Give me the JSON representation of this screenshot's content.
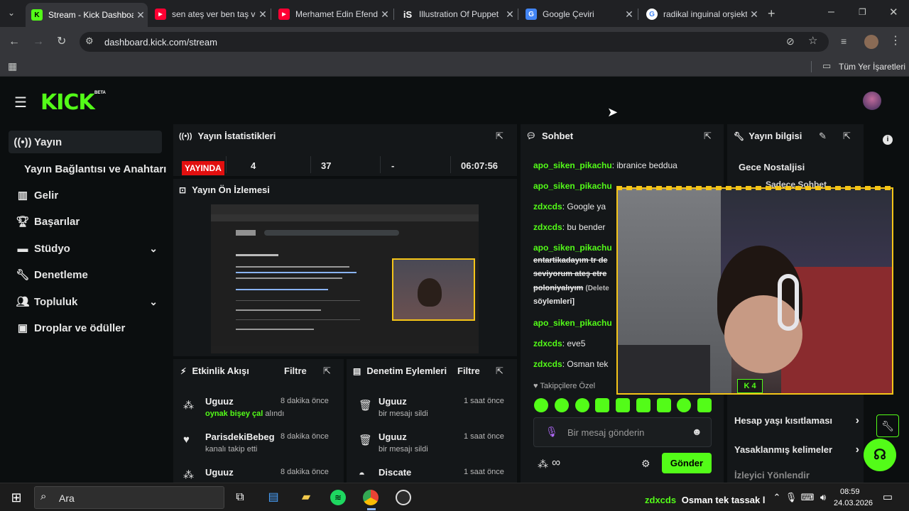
{
  "browser": {
    "tabs": [
      {
        "title": "Stream - Kick Dashboard",
        "favicon": "kick-icon",
        "color": "#53fc18"
      },
      {
        "title": "sen ateş ver ben taş ver",
        "favicon": "youtube-icon",
        "color": "#ff0033"
      },
      {
        "title": "Merhamet Edin Efendi",
        "favicon": "youtube-icon",
        "color": "#ff0033"
      },
      {
        "title": "Illustration Of Puppet",
        "favicon": "istock-icon",
        "color": "#ffffff"
      },
      {
        "title": "Google Çeviri",
        "favicon": "translate-icon",
        "color": "#4285f4"
      },
      {
        "title": "radikal inguinal orşiekt",
        "favicon": "google-icon",
        "color": "#ffffff"
      }
    ],
    "url": "dashboard.kick.com/stream",
    "bookmarks_label": "Tüm Yer İşaretleri"
  },
  "brand": {
    "logo": "KICK",
    "beta": "BETA",
    "accent": "#53fc18"
  },
  "sidebar": {
    "items": [
      {
        "label": "Yayın",
        "icon": "broadcast-icon"
      },
      {
        "label": "Yayın Bağlantısı ve Anahtarı",
        "icon": ""
      },
      {
        "label": "Gelir",
        "icon": "chart-icon"
      },
      {
        "label": "Başarılar",
        "icon": "trophy-icon"
      },
      {
        "label": "Stüdyo",
        "icon": "studio-icon"
      },
      {
        "label": "Denetleme",
        "icon": "wrench-icon"
      },
      {
        "label": "Topluluk",
        "icon": "people-icon"
      },
      {
        "label": "Droplar ve ödüller",
        "icon": "gift-icon"
      }
    ]
  },
  "stats": {
    "title": "Yayın İstatistikleri",
    "live_badge": "YAYINDA",
    "viewers": "4",
    "followers": "37",
    "subs": "-",
    "uptime": "06:07:56"
  },
  "preview": {
    "title": "Yayın Ön İzlemesi"
  },
  "activity": {
    "title": "Etkinlik Akışı",
    "filter": "Filtre",
    "items": [
      {
        "user": "Uguuz",
        "highlight": "oynak bişey çal",
        "text": " alındı",
        "time": "8 dakika önce"
      },
      {
        "user": "ParisdekiBebeg",
        "highlight": "",
        "text": "kanalı takip etti",
        "time": "8 dakika önce"
      },
      {
        "user": "Uguuz",
        "highlight": "",
        "text": "",
        "time": "8 dakika önce"
      }
    ]
  },
  "moderation": {
    "title": "Denetim Eylemleri",
    "filter": "Filtre",
    "items": [
      {
        "user": "Uguuz",
        "text": "bir mesajı sildi",
        "time": "1 saat önce"
      },
      {
        "user": "Uguuz",
        "text": "bir mesajı sildi",
        "time": "1 saat önce"
      },
      {
        "user": "Discate",
        "text": "",
        "time": "1 saat önce"
      }
    ]
  },
  "chat": {
    "title": "Sohbet",
    "messages": [
      {
        "user": "apo_siken_pikachu",
        "text": ": ibranice beddua"
      },
      {
        "user": "apo_siken_pikachu",
        "text": ""
      },
      {
        "user": "zdxcds",
        "text": ": Google ya"
      },
      {
        "user": "zdxcds",
        "text": ": bu bender"
      },
      {
        "user": "apo_siken_pikachu",
        "text": ""
      },
      {
        "user": "",
        "text": "entartikadayım tr de"
      },
      {
        "user": "",
        "text": "seviyorum ateş etre"
      },
      {
        "user": "",
        "text": "poloniyalıyım"
      },
      {
        "user": "",
        "text": "söylemleri]"
      },
      {
        "user": "apo_siken_pikachu",
        "text": ""
      },
      {
        "user": "zdxcds",
        "text": ": eve5"
      },
      {
        "user": "zdxcds",
        "text": ": Osman tek"
      }
    ],
    "deleted_tag": "(Delete",
    "followers_only": "Takipçilere Özel",
    "input_placeholder": "Bir mesaj gönderin",
    "send": "Gönder",
    "infinity": "∞"
  },
  "stream_info": {
    "title": "Yayın bilgisi",
    "stream_name": "Gece Nostaljisi",
    "partial": "Sadece Sohbet",
    "rows": [
      "Hesap yaşı kısıtlaması",
      "Yasaklanmış kelimeler",
      "İzleyici Yönlendir"
    ]
  },
  "webcam": {
    "badge": "4"
  },
  "taskbar": {
    "search_placeholder": "Ara",
    "ticker_user": "zdxcds",
    "ticker_text": "Osman tek tassak l",
    "time": "08:59",
    "date": "24.03.2026"
  }
}
